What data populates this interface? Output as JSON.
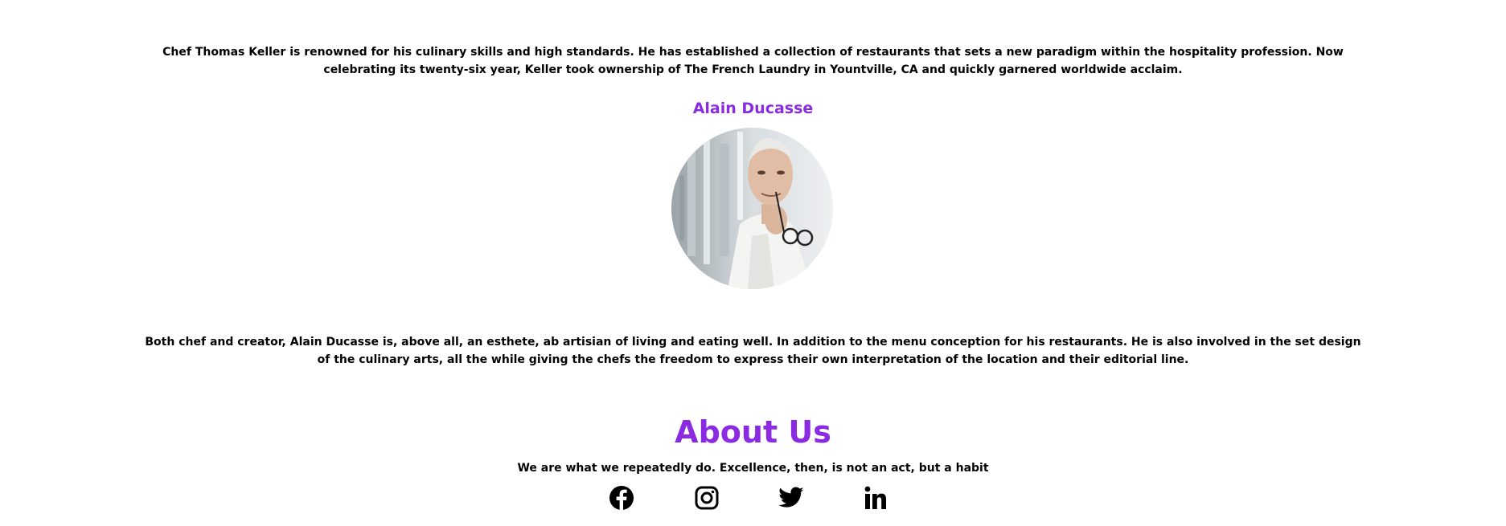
{
  "chef1": {
    "bio": "Chef Thomas Keller is renowned for his culinary skills and high standards. He has established a collection of restaurants that sets a new paradigm within the hospitality profession. Now celebrating its twenty-six year, Keller took ownership of The French Laundry in Yountville, CA and quickly garnered worldwide acclaim."
  },
  "chef2": {
    "name": "Alain Ducasse",
    "bio": "Both chef and creator, Alain Ducasse is, above all, an esthete, ab artisian of living and eating well. In addition to the menu conception for his restaurants. He is also involved in the set design of the culinary arts, all the while giving the chefs the freedom to express their own interpretation of the location and their editorial line."
  },
  "about": {
    "title": "About Us",
    "tagline": "We are what we repeatedly do. Excellence, then, is not an act, but a habit"
  },
  "social": {
    "icons": [
      "facebook-icon",
      "instagram-icon",
      "twitter-icon",
      "linkedin-icon"
    ]
  },
  "colors": {
    "accent": "#8a2be2",
    "text": "#000000",
    "background": "#ffffff"
  }
}
